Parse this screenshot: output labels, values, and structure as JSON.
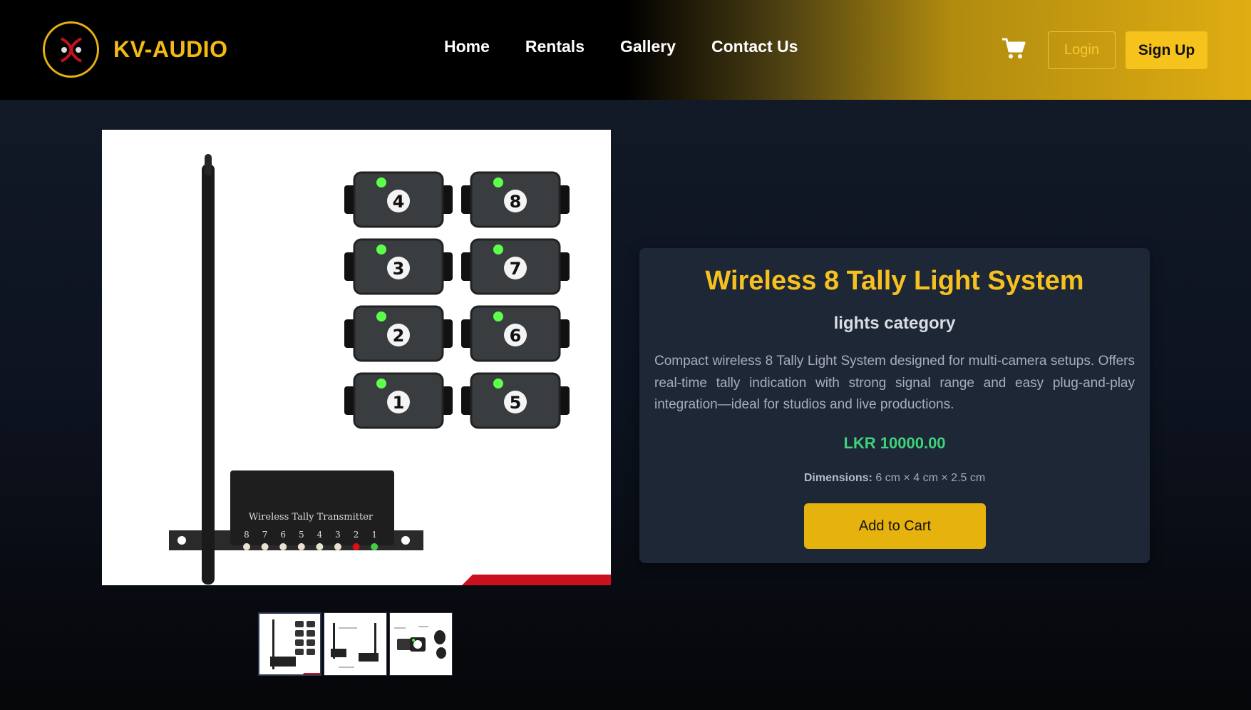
{
  "header": {
    "brand": "KV-AUDIO",
    "nav": [
      "Home",
      "Rentals",
      "Gallery",
      "Contact Us"
    ],
    "login_label": "Login",
    "signup_label": "Sign Up",
    "cart_icon": "shopping-cart-icon"
  },
  "product": {
    "title": "Wireless 8 Tally Light System",
    "category": "lights category",
    "description": "Compact wireless 8 Tally Light System designed for multi-camera setups. Offers real-time tally indication with strong signal range and easy plug-and-play integration—ideal for studios and live productions.",
    "price": "LKR 10000.00",
    "dimensions_label": "Dimensions:",
    "dimensions_value": "6 cm × 4 cm × 2.5 cm",
    "add_to_cart_label": "Add to Cart",
    "image_text": {
      "transmitter_label": "Wireless Tally Transmitter",
      "transmitter_numbers": [
        "8",
        "7",
        "6",
        "5",
        "4",
        "3",
        "2",
        "1"
      ],
      "light_numbers": [
        "4",
        "8",
        "3",
        "7",
        "2",
        "6",
        "1",
        "5"
      ]
    },
    "thumbnail_count": 3
  },
  "colors": {
    "accent": "#f5c020",
    "price": "#3fd27c",
    "card_bg": "#1d2735",
    "button": "#e6b20e"
  }
}
